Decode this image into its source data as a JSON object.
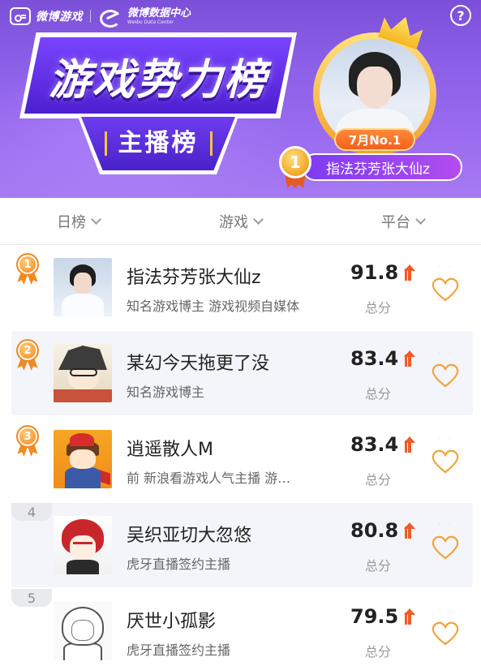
{
  "header": {
    "brand": "微博游戏",
    "data_center_cn": "微博数据中心",
    "data_center_en": "Weibo Data Center",
    "help": "?",
    "title": "游戏势力榜",
    "subtitle": "主播榜",
    "champion": {
      "month_label": "7月No.1",
      "rank": "1",
      "name": "指法芬芳张大仙z"
    }
  },
  "filters": [
    {
      "label": "日榜"
    },
    {
      "label": "游戏"
    },
    {
      "label": "平台"
    }
  ],
  "score_label": "总分",
  "rows": [
    {
      "rank": "1",
      "name": "指法芬芳张大仙z",
      "desc": "知名游戏博主 游戏视频自媒体",
      "score": "91.8",
      "trend": "up"
    },
    {
      "rank": "2",
      "name": "某幻今天拖更了没",
      "desc": "知名游戏博主",
      "score": "83.4",
      "trend": "up"
    },
    {
      "rank": "3",
      "name": "逍遥散人M",
      "desc": "前 新浪看游戏人气主播 游…",
      "score": "83.4",
      "trend": "up"
    },
    {
      "rank": "4",
      "name": "吴织亚切大忽悠",
      "desc": "虎牙直播签约主播",
      "score": "80.8",
      "trend": "up"
    },
    {
      "rank": "5",
      "name": "厌世小孤影",
      "desc": "虎牙直播签约主播",
      "score": "79.5",
      "trend": "up"
    }
  ],
  "colors": {
    "header_purple": "#8a5ee6",
    "medal_orange": "#f4932a",
    "trend_up": "#ef5b2a",
    "heart": "#f2a23a"
  }
}
